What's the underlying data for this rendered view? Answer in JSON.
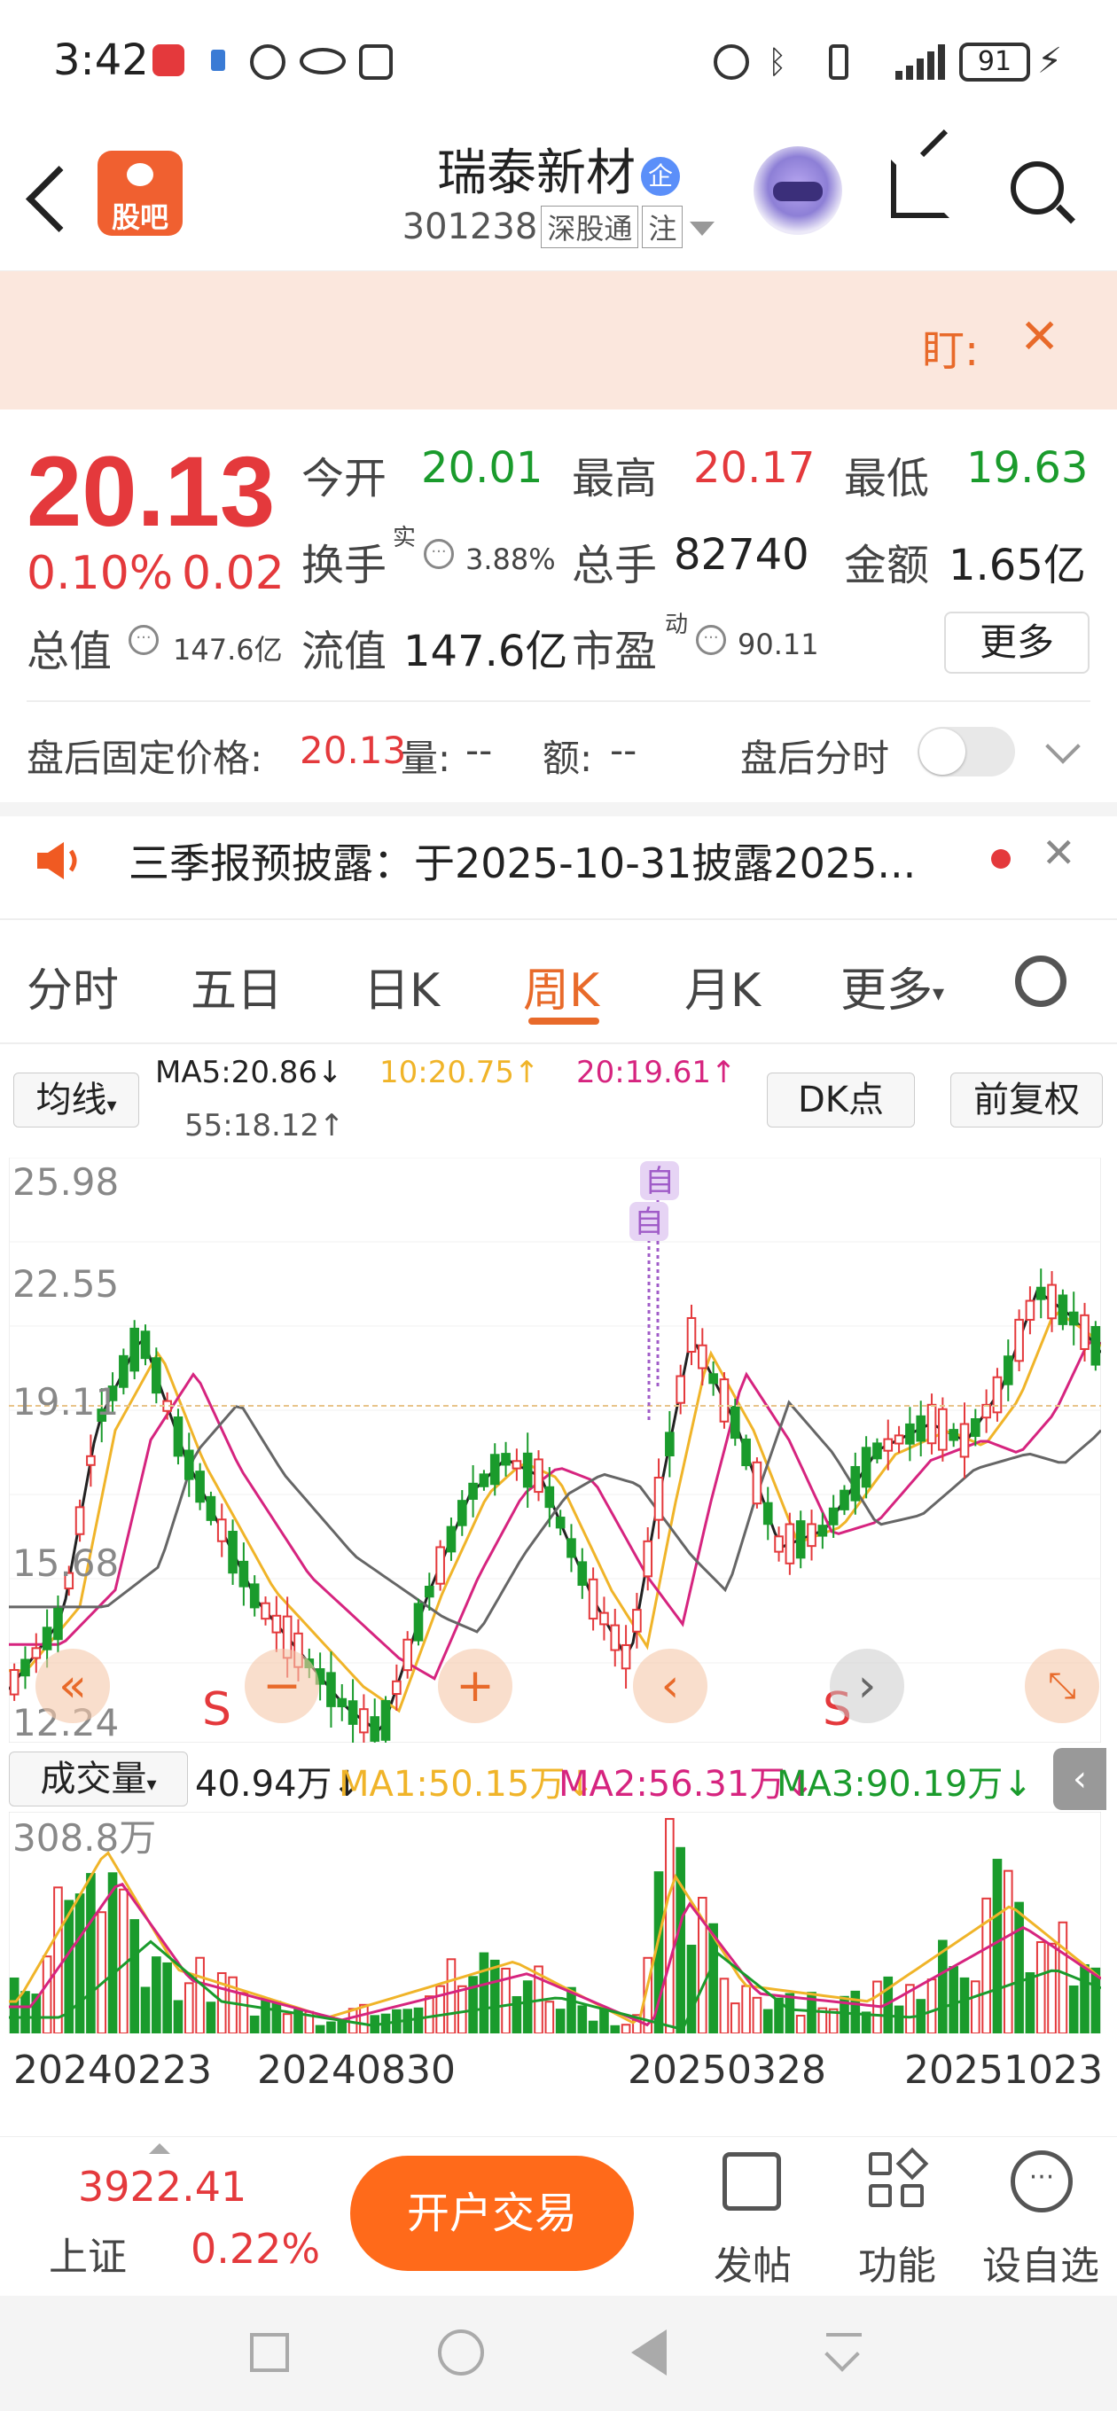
{
  "status_bar": {
    "time": "3:42",
    "battery": "91"
  },
  "header": {
    "app_logo_text": "股吧",
    "stock_name": "瑞泰新材",
    "ent_badge": "企",
    "code": "301238",
    "tag1": "深股通",
    "tag2": "注"
  },
  "banner": {
    "text": "盯:"
  },
  "quote": {
    "price": "20.13",
    "change_pct": "0.10%",
    "change": "0.02",
    "open_label": "今开",
    "open": "20.01",
    "high_label": "最高",
    "high": "20.17",
    "low_label": "最低",
    "low": "19.63",
    "turnover_label": "换手",
    "turnover_sup": "实",
    "turnover": "3.88%",
    "volume_label": "总手",
    "volume": "82740",
    "amount_label": "金额",
    "amount": "1.65亿",
    "mcap_label": "总值",
    "mcap": "147.6亿",
    "float_label": "流值",
    "float_cap": "147.6亿",
    "pe_label": "市盈",
    "pe_sup": "动",
    "pe": "90.11",
    "more_label": "更多"
  },
  "after_hours": {
    "label": "盘后固定价格:",
    "price": "20.13",
    "vol_label": "量:",
    "vol": "--",
    "amt_label": "额:",
    "amt": "--",
    "timeshare_label": "盘后分时"
  },
  "notice": {
    "text": "三季报预披露：于2025-10-31披露2025..."
  },
  "tabs": [
    "分时",
    "五日",
    "日K",
    "周K",
    "月K",
    "更多"
  ],
  "ma_row": {
    "selector": "均线",
    "ma5": "MA5:20.86↓",
    "ma10": "10:20.75↑",
    "ma20": "20:19.61↑",
    "ma55": "55:18.12↑",
    "dk_btn": "DK点",
    "fq_btn": "前复权"
  },
  "kchart": {
    "y_labels": [
      "25.98",
      "22.55",
      "19.11",
      "15.68",
      "12.24"
    ],
    "markers": [
      "自",
      "自"
    ],
    "signals": [
      "S",
      "S"
    ],
    "colors": {
      "up": "#e4393c",
      "down": "#1a9b2c",
      "ma5": "#222222",
      "ma10": "#f0b429",
      "ma20": "#d6247f",
      "ma55": "#666666"
    }
  },
  "vol_row": {
    "selector": "成交量",
    "vol": "40.94万↓",
    "ma1": "MA1:50.15万↓",
    "ma2": "MA2:56.31万↓",
    "ma3": "MA3:90.19万↓",
    "max_label": "308.8万"
  },
  "dates": [
    "20240223",
    "20240830",
    "20250328",
    "20251023"
  ],
  "bottom": {
    "index_value": "3922.41",
    "index_name": "上证",
    "index_change": "0.22%",
    "trade_btn": "开户交易",
    "post_label": "发帖",
    "func_label": "功能",
    "custom_label": "设自选"
  }
}
